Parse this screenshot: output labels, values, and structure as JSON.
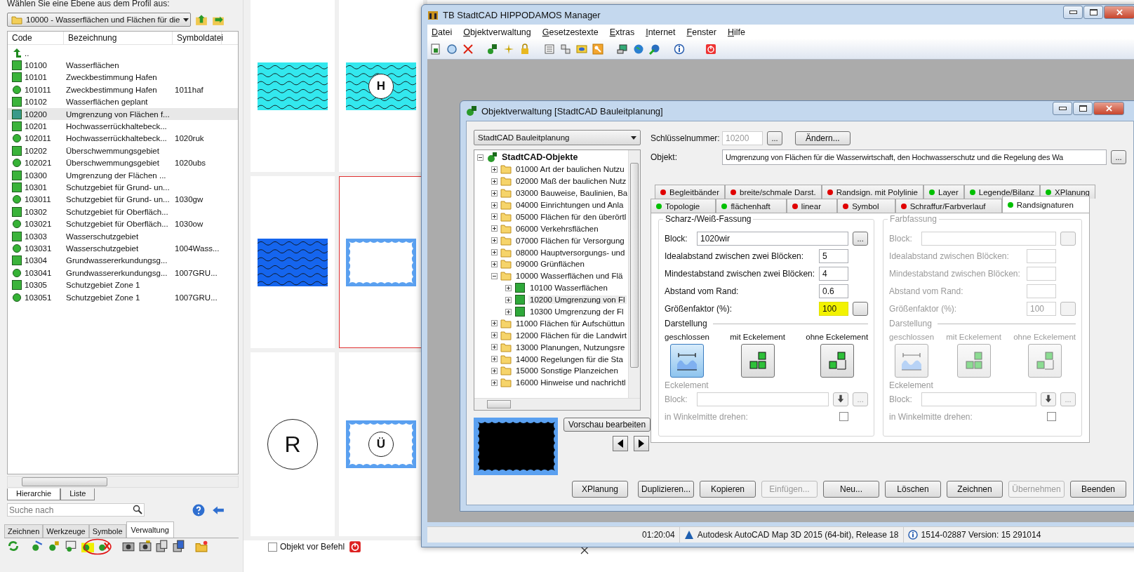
{
  "profile_panel": {
    "prompt": "Wählen Sie eine Ebene aus dem Profil aus:",
    "layer_select": "10000 - Wasserflächen und Flächen für die",
    "columns": [
      "Code",
      "Bezeichnung",
      "Symboldatei"
    ],
    "rows": [
      {
        "kind": "up",
        "code": "..",
        "selected": false
      },
      {
        "kind": "area",
        "code": "10100",
        "name": "Wasserflächen",
        "selected": false
      },
      {
        "kind": "area",
        "code": "10101",
        "name": "Zweckbestimmung Hafen",
        "selected": false
      },
      {
        "kind": "symbol",
        "code": "101011",
        "name": "Zweckbestimmung Hafen",
        "file": "1011haf",
        "selected": false
      },
      {
        "kind": "area",
        "code": "10102",
        "name": "Wasserflächen geplant",
        "selected": false
      },
      {
        "kind": "area",
        "code": "10200",
        "name": "Umgrenzung von Flächen f...",
        "selected": true
      },
      {
        "kind": "area",
        "code": "10201",
        "name": "Hochwasserrückhaltebeck...",
        "selected": false
      },
      {
        "kind": "symbol",
        "code": "102011",
        "name": "Hochwasserrückhaltebeck...",
        "file": "1020ruk",
        "selected": false
      },
      {
        "kind": "area",
        "code": "10202",
        "name": "Überschwemmungsgebiet",
        "selected": false
      },
      {
        "kind": "symbol",
        "code": "102021",
        "name": "Überschwemmungsgebiet",
        "file": "1020ubs",
        "selected": false
      },
      {
        "kind": "area",
        "code": "10300",
        "name": "Umgrenzung der Flächen ...",
        "selected": false
      },
      {
        "kind": "area",
        "code": "10301",
        "name": "Schutzgebiet für Grund- un...",
        "selected": false
      },
      {
        "kind": "symbol",
        "code": "103011",
        "name": "Schutzgebiet für Grund- un...",
        "file": "1030gw",
        "selected": false
      },
      {
        "kind": "area",
        "code": "10302",
        "name": "Schutzgebiet für Oberfläch...",
        "selected": false
      },
      {
        "kind": "symbol",
        "code": "103021",
        "name": "Schutzgebiet für Oberfläch...",
        "file": "1030ow",
        "selected": false
      },
      {
        "kind": "area",
        "code": "10303",
        "name": "Wasserschutzgebiet",
        "selected": false
      },
      {
        "kind": "symbol",
        "code": "103031",
        "name": "Wasserschutzgebiet",
        "file": "1004Wass...",
        "selected": false
      },
      {
        "kind": "area",
        "code": "10304",
        "name": "Grundwassererkundungsg...",
        "selected": false
      },
      {
        "kind": "symbol",
        "code": "103041",
        "name": "Grundwassererkundungsg...",
        "file": "1007GRU...",
        "selected": false
      },
      {
        "kind": "area",
        "code": "10305",
        "name": "Schutzgebiet Zone 1",
        "selected": false
      },
      {
        "kind": "symbol",
        "code": "103051",
        "name": "Schutzgebiet Zone 1",
        "file": "1007GRU...",
        "selected": false
      }
    ],
    "view_tabs": [
      {
        "label": "Hierarchie",
        "selected": true
      },
      {
        "label": "Liste",
        "selected": false
      }
    ],
    "search": {
      "placeholder": "Suche nach"
    },
    "main_tabs": [
      {
        "label": "Zeichnen",
        "selected": false
      },
      {
        "label": "Werkzeuge",
        "selected": false
      },
      {
        "label": "Symbole",
        "selected": false
      },
      {
        "label": "Verwaltung",
        "selected": true
      }
    ],
    "object_before_command": {
      "label": "Objekt vor Befehl",
      "checked": false
    }
  },
  "preview_cells": [
    {
      "kind": "wave_light",
      "selected": false
    },
    {
      "kind": "wave_light",
      "letter": "H",
      "selected": false
    },
    {
      "kind": "wave_dark",
      "selected": false
    },
    {
      "kind": "frame",
      "selected": true
    },
    {
      "kind": "circle",
      "letter": "R",
      "selected": false
    },
    {
      "kind": "frame",
      "letter": "Ü",
      "selected": false
    }
  ],
  "manager": {
    "title": "TB StadtCAD HIPPODAMOS Manager",
    "menu": [
      "Datei",
      "Objektverwaltung",
      "Gesetzestexte",
      "Extras",
      "Internet",
      "Fenster",
      "Hilfe"
    ],
    "dialog": {
      "title": "Objektverwaltung [StadtCAD Bauleitplanung]",
      "catalog": "StadtCAD Bauleitplanung",
      "tree": {
        "label": "StadtCAD-Objekte",
        "kind": "root",
        "expanded": true,
        "selected": false,
        "children": [
          {
            "label": "01000 Art der baulichen Nutzu",
            "kind": "folder",
            "expanded": false,
            "selected": false
          },
          {
            "label": "02000 Maß der baulichen Nutz",
            "kind": "folder",
            "expanded": false,
            "selected": false
          },
          {
            "label": "03000 Bauweise, Baulinien, Ba",
            "kind": "folder",
            "expanded": false,
            "selected": false
          },
          {
            "label": "04000 Einrichtungen und Anla",
            "kind": "folder",
            "expanded": false,
            "selected": false
          },
          {
            "label": "05000 Flächen für den überörtl",
            "kind": "folder",
            "expanded": false,
            "selected": false
          },
          {
            "label": "06000 Verkehrsflächen",
            "kind": "folder",
            "expanded": false,
            "selected": false
          },
          {
            "label": "07000 Flächen für Versorgung",
            "kind": "folder",
            "expanded": false,
            "selected": false
          },
          {
            "label": "08000 Hauptversorgungs- und",
            "kind": "folder",
            "expanded": false,
            "selected": false
          },
          {
            "label": "09000 Grünflächen",
            "kind": "folder",
            "expanded": false,
            "selected": false
          },
          {
            "label": "10000 Wasserflächen und Flä",
            "kind": "folder",
            "expanded": true,
            "selected": false,
            "children": [
              {
                "label": "10100 Wasserflächen",
                "kind": "object",
                "expanded": false,
                "selected": false
              },
              {
                "label": "10200 Umgrenzung von Fl",
                "kind": "object",
                "expanded": false,
                "selected": true
              },
              {
                "label": "10300 Umgrenzung der Fl",
                "kind": "object",
                "expanded": false,
                "selected": false
              }
            ]
          },
          {
            "label": "11000 Flächen für Aufschüttun",
            "kind": "folder",
            "expanded": false,
            "selected": false
          },
          {
            "label": "12000 Flächen für die Landwirt",
            "kind": "folder",
            "expanded": false,
            "selected": false
          },
          {
            "label": "13000 Planungen, Nutzungsre",
            "kind": "folder",
            "expanded": false,
            "selected": false
          },
          {
            "label": "14000 Regelungen für die Sta",
            "kind": "folder",
            "expanded": false,
            "selected": false
          },
          {
            "label": "15000 Sonstige Planzeichen",
            "kind": "folder",
            "expanded": false,
            "selected": false
          },
          {
            "label": "16000 Hinweise und nachrichtl",
            "kind": "folder",
            "expanded": false,
            "selected": false
          }
        ]
      },
      "preview_button": "Vorschau bearbeiten",
      "key_label": "Schlüsselnummer:",
      "key_value": "10200",
      "key_browse": "...",
      "change_button": "Ändern...",
      "object_label": "Objekt:",
      "object_value": "Umgrenzung von Flächen für die Wasserwirtschaft, den Hochwasserschutz und die Regelung des Wa",
      "object_browse": "...",
      "tab_rows": [
        {
          "tabs": [
            {
              "label": "Begleitbänder",
              "color": "#e00000",
              "selected": false
            },
            {
              "label": "breite/schmale Darst.",
              "color": "#e00000",
              "selected": false
            },
            {
              "label": "Randsign. mit Polylinie",
              "color": "#e00000",
              "selected": false
            },
            {
              "label": "Layer",
              "color": "#00c000",
              "selected": false
            },
            {
              "label": "Legende/Bilanz",
              "color": "#00c000",
              "selected": false
            },
            {
              "label": "XPlanung",
              "color": "#00c000",
              "selected": false
            }
          ]
        },
        {
          "tabs": [
            {
              "label": "Topologie",
              "color": "#00c000",
              "selected": false
            },
            {
              "label": "flächenhaft",
              "color": "#00c000",
              "selected": false
            },
            {
              "label": "linear",
              "color": "#e00000",
              "selected": false
            },
            {
              "label": "Symbol",
              "color": "#e00000",
              "selected": false
            },
            {
              "label": "Schraffur/Farbverlauf",
              "color": "#e00000",
              "selected": false
            },
            {
              "label": "Randsignaturen",
              "color": "#00c000",
              "selected": true
            }
          ]
        }
      ],
      "groups": [
        {
          "title": "Scharz-/Weiß-Fassung",
          "enabled": true,
          "block_label": "Block:",
          "block_value": "1020wir",
          "block_browse": "...",
          "fields": [
            {
              "label": "Idealabstand zwischen zwei Blöcken:",
              "value": "5",
              "highlighted": false
            },
            {
              "label": "Mindestabstand zwischen zwei Blöcken:",
              "value": "4",
              "highlighted": false
            },
            {
              "label": "Abstand vom Rand:",
              "value": "0.6",
              "highlighted": false
            },
            {
              "label": "Größenfaktor (%):",
              "value": "100",
              "highlighted": true,
              "kind": "with_button"
            }
          ],
          "display_label": "Darstellung",
          "modes": [
            {
              "label": "geschlossen",
              "kind": "closed",
              "selected": true
            },
            {
              "label": "mit Eckelement",
              "kind": "with_corner",
              "selected": false
            },
            {
              "label": "ohne Eckelement",
              "kind": "without_corner",
              "selected": false
            }
          ],
          "corner": {
            "heading": "Eckelement",
            "block_label": "Block:",
            "block_browse": "...",
            "rotate_label": "in Winkelmitte drehen:",
            "rotate_checked": false
          }
        },
        {
          "title": "Farbfassung",
          "enabled": false,
          "block_label": "Block:",
          "fields": [
            {
              "label": "Idealabstand zwischen Blöcken:",
              "highlighted": false
            },
            {
              "label": "Mindestabstand zwischen Blöcken:",
              "highlighted": false
            },
            {
              "label": "Abstand vom Rand:",
              "highlighted": false
            },
            {
              "label": "Größenfaktor (%):",
              "value": "100",
              "highlighted": false,
              "kind": "with_button"
            }
          ],
          "display_label": "Darstellung",
          "modes": [
            {
              "label": "geschlossen",
              "kind": "closed",
              "selected": false
            },
            {
              "label": "mit Eckelement",
              "kind": "with_corner",
              "selected": false
            },
            {
              "label": "ohne Eckelement",
              "kind": "without_corner",
              "selected": false
            }
          ],
          "corner": {
            "heading": "Eckelement",
            "block_label": "Block:",
            "block_browse": "...",
            "rotate_label": "in Winkelmitte drehen:",
            "rotate_checked": false
          }
        }
      ],
      "buttons": [
        {
          "label": "XPlanung",
          "disabled": false
        },
        {
          "label": "Duplizieren...",
          "disabled": false
        },
        {
          "label": "Kopieren",
          "disabled": false
        },
        {
          "label": "Einfügen...",
          "disabled": true
        },
        {
          "label": "Neu...",
          "disabled": false
        },
        {
          "label": "Löschen",
          "disabled": false
        },
        {
          "label": "Zeichnen",
          "disabled": false
        },
        {
          "label": "Übernehmen",
          "disabled": true
        },
        {
          "label": "Beenden",
          "disabled": false
        }
      ]
    },
    "status_bar": {
      "time": "01:20:04",
      "product": "Autodesk AutoCAD Map 3D 2015 (64-bit), Release 18",
      "version": "1514-02887 Version: 15 291014"
    }
  }
}
